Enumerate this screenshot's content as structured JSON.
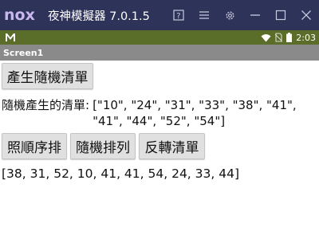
{
  "emulator": {
    "logo": "nox",
    "title": "夜神模擬器 7.0.1.5",
    "controls": [
      "help-icon",
      "menu-icon",
      "settings-icon",
      "minimize-icon",
      "maximize-icon",
      "close-icon"
    ]
  },
  "status_bar": {
    "left_icon": "m-notification-icon",
    "icons": [
      "wifi-icon",
      "no-sim-icon",
      "battery-icon"
    ],
    "time": "2:03"
  },
  "screen": {
    "title": "Screen1"
  },
  "buttons": {
    "generate": "產生隨機清單",
    "sort": "照順序排",
    "shuffle": "隨機排列",
    "reverse": "反轉清單"
  },
  "random_list": {
    "label": "隨機產生的清單:",
    "value": "[\"10\", \"24\", \"31\", \"33\", \"38\", \"41\", \"41\", \"44\", \"52\", \"54\"]"
  },
  "result": "[38, 31, 52, 10, 41, 41, 54, 24, 33, 44]",
  "colors": {
    "emulator_bar": "#2e3359",
    "nox_logo": "#c9b8f0",
    "status_bar": "#5a6e2a",
    "title_bar": "#8a8a8a",
    "button": "#e0e0e0"
  }
}
